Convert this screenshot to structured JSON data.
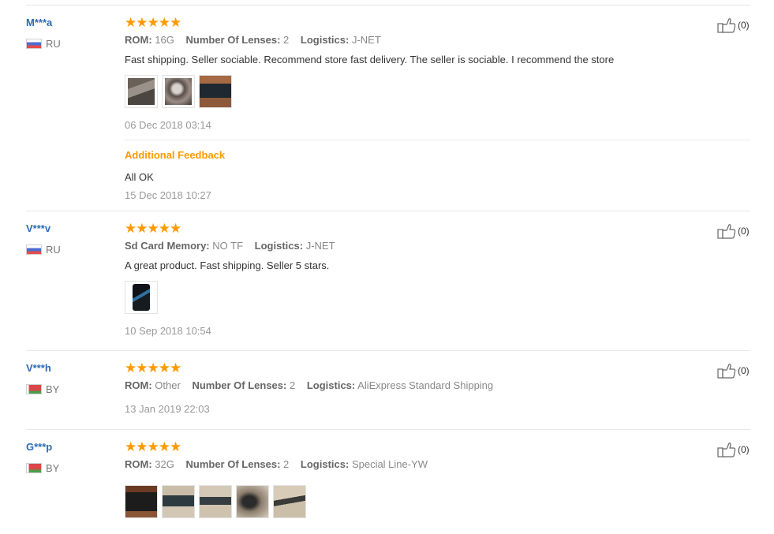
{
  "reviews": [
    {
      "user": "M***a",
      "country": "RU",
      "flag": "ru",
      "stars": "★★★★★",
      "attributes": [
        {
          "key": "ROM:",
          "value": "16G"
        },
        {
          "key": "Number Of Lenses:",
          "value": "2"
        },
        {
          "key": "Logistics:",
          "value": "J-NET"
        }
      ],
      "text": "Fast shipping. Seller sociable. Recommend store fast delivery. The seller is sociable. I recommend the store",
      "date": "06 Dec 2018 03:14",
      "helpful_count": "(0)",
      "additional": {
        "label": "Additional Feedback",
        "text": "All OK",
        "date": "15 Dec 2018 10:27"
      }
    },
    {
      "user": "V***v",
      "country": "RU",
      "flag": "ru",
      "stars": "★★★★★",
      "attributes": [
        {
          "key": "Sd Card Memory:",
          "value": "NO TF"
        },
        {
          "key": "Logistics:",
          "value": "J-NET"
        }
      ],
      "text": "A great product. Fast shipping. Seller 5 stars.",
      "date": "10 Sep 2018 10:54",
      "helpful_count": "(0)"
    },
    {
      "user": "V***h",
      "country": "BY",
      "flag": "by",
      "stars": "★★★★★",
      "attributes": [
        {
          "key": "ROM:",
          "value": "Other"
        },
        {
          "key": "Number Of Lenses:",
          "value": "2"
        },
        {
          "key": "Logistics:",
          "value": "AliExpress Standard Shipping"
        }
      ],
      "date": "13 Jan 2019 22:03",
      "helpful_count": "(0)"
    },
    {
      "user": "G***p",
      "country": "BY",
      "flag": "by",
      "stars": "★★★★★",
      "attributes": [
        {
          "key": "ROM:",
          "value": "32G"
        },
        {
          "key": "Number Of Lenses:",
          "value": "2"
        },
        {
          "key": "Logistics:",
          "value": "Special Line-YW"
        }
      ],
      "helpful_count": "(0)"
    }
  ],
  "colors": {
    "username": "#2a6bb5",
    "stars": "#ff9900",
    "additional_feedback": "#ff9900",
    "date": "#999999"
  },
  "icons": [
    "thumbs-up-icon",
    "flag-ru-icon",
    "flag-by-icon",
    "star-icon"
  ]
}
